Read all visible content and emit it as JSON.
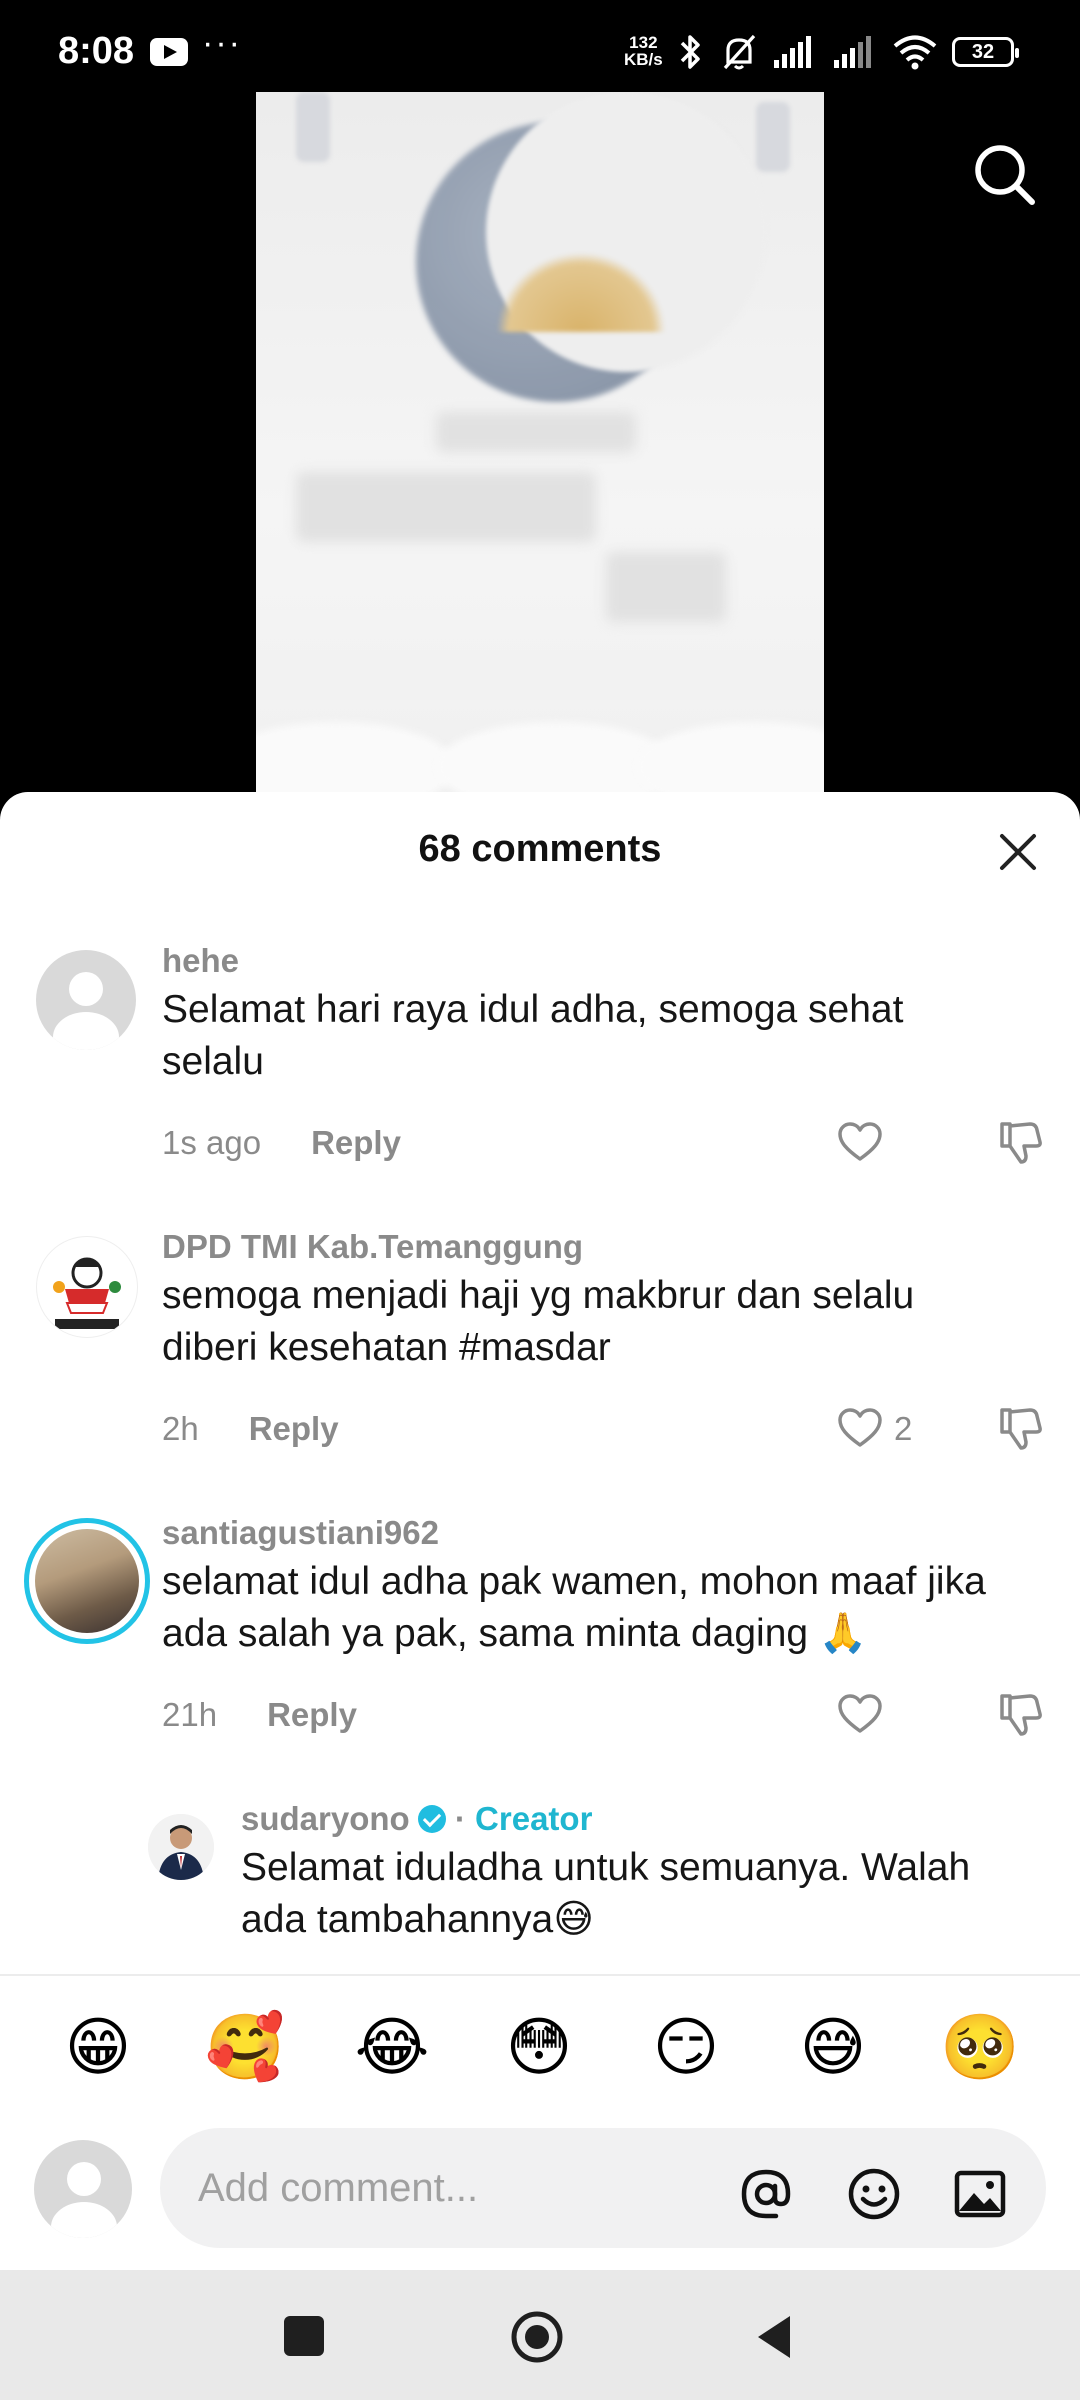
{
  "status_bar": {
    "time": "8:08",
    "more": "···",
    "net_speed_value": "132",
    "net_speed_unit": "KB/s",
    "battery": "32"
  },
  "sheet": {
    "title": "68 comments"
  },
  "comments": [
    {
      "username": "hehe",
      "text": "Selamat hari raya idul adha, semoga sehat selalu",
      "time": "1s ago",
      "reply": "Reply",
      "likes": ""
    },
    {
      "username": "DPD TMI Kab.Temanggung",
      "text": "semoga menjadi haji yg makbrur dan selalu diberi kesehatan #masdar",
      "time": "2h",
      "reply": "Reply",
      "likes": "2"
    },
    {
      "username": "santiagustiani962",
      "text": "selamat idul adha pak wamen, mohon maaf jika ada salah ya pak, sama minta daging 🙏",
      "time": "21h",
      "reply": "Reply",
      "likes": ""
    }
  ],
  "creator_reply": {
    "username": "sudaryono",
    "separator": "·",
    "tag": "Creator",
    "text": "Selamat iduladha untuk semuanya. Walah ada tambahannya😅"
  },
  "emoji_bar": [
    "😁",
    "🥰",
    "😂",
    "😳",
    "😏",
    "😅",
    "🥺"
  ],
  "input": {
    "placeholder": "Add comment..."
  },
  "colors": {
    "accent": "#1fb6d0",
    "text_primary": "#161616",
    "text_secondary": "#8a8a8a"
  },
  "icons": [
    "search-icon",
    "close-icon",
    "heart-icon",
    "dislike-icon",
    "mention-icon",
    "emoji-icon",
    "image-icon",
    "verified-icon"
  ]
}
